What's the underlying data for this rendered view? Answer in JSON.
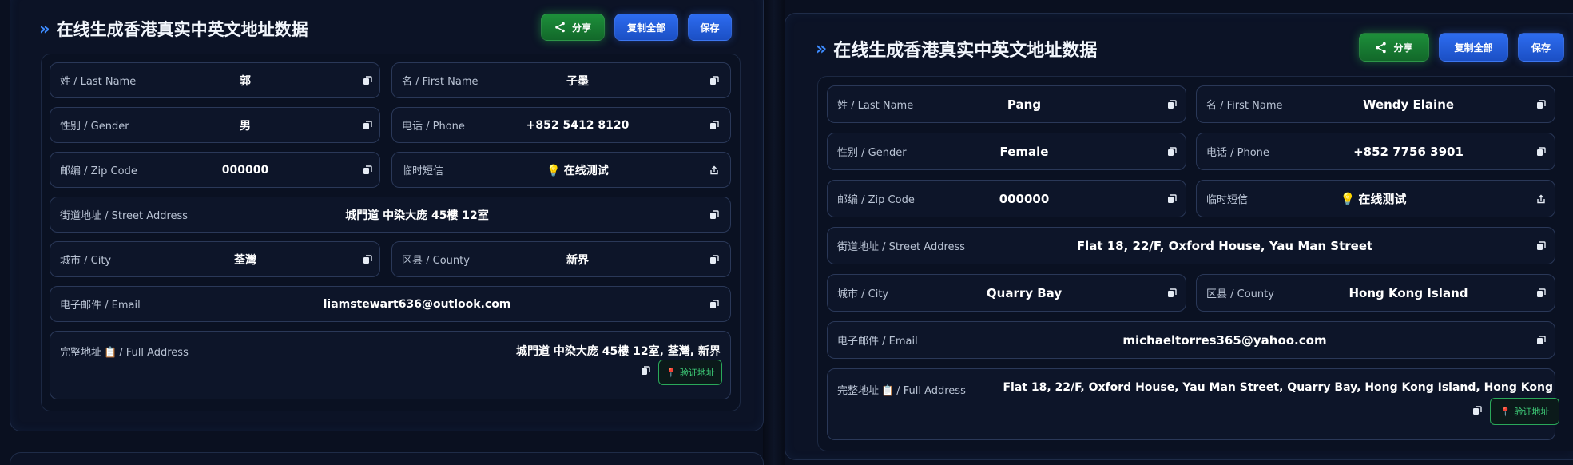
{
  "header": {
    "title": "在线生成香港真实中英文地址数据",
    "share_label": "分享",
    "copy_all_label": "复制全部",
    "save_label": "保存"
  },
  "labels": {
    "last_name": "姓 / Last Name",
    "first_name": "名 / First Name",
    "gender": "性别 / Gender",
    "phone": "电话 / Phone",
    "zip": "邮编 / Zip Code",
    "sms": "临时短信",
    "street": "街道地址 / Street Address",
    "city": "城市 / City",
    "county": "区县 / County",
    "email": "电子邮件 / Email",
    "full_address_prefix": "完整地址",
    "full_address_suffix": "/ Full Address",
    "verify": "验证地址",
    "sms_link": "在线测试"
  },
  "left": {
    "last_name": "郭",
    "first_name": "子墨",
    "gender": "男",
    "phone": "+852 5412 8120",
    "zip": "000000",
    "street": "城門道 中染大庞 45樓 12室",
    "city": "荃灣",
    "county": "新界",
    "email": "liamstewart636@outlook.com",
    "full_address": "城門道 中染大庞 45樓 12室, 荃灣, 新界"
  },
  "right": {
    "last_name": "Pang",
    "first_name": "Wendy Elaine",
    "gender": "Female",
    "phone": "+852 7756 3901",
    "zip": "000000",
    "street": "Flat 18, 22/F, Oxford House, Yau Man Street",
    "city": "Quarry Bay",
    "county": "Hong Kong Island",
    "email": "michaeltorres365@yahoo.com",
    "full_address": "Flat 18, 22/F, Oxford House, Yau Man Street, Quarry Bay, Hong Kong Island, Hong Kong"
  },
  "colors": {
    "accent_blue": "#2d6cf0",
    "accent_green": "#1d8f3a",
    "background": "#0a1020"
  },
  "icons": {
    "copy": "copy-icon",
    "share": "share-icon",
    "external": "external-link-icon",
    "bulb": "lightbulb-icon",
    "clipboard": "clipboard-icon",
    "pin": "pin-icon",
    "chevron": "double-chevron-icon"
  }
}
